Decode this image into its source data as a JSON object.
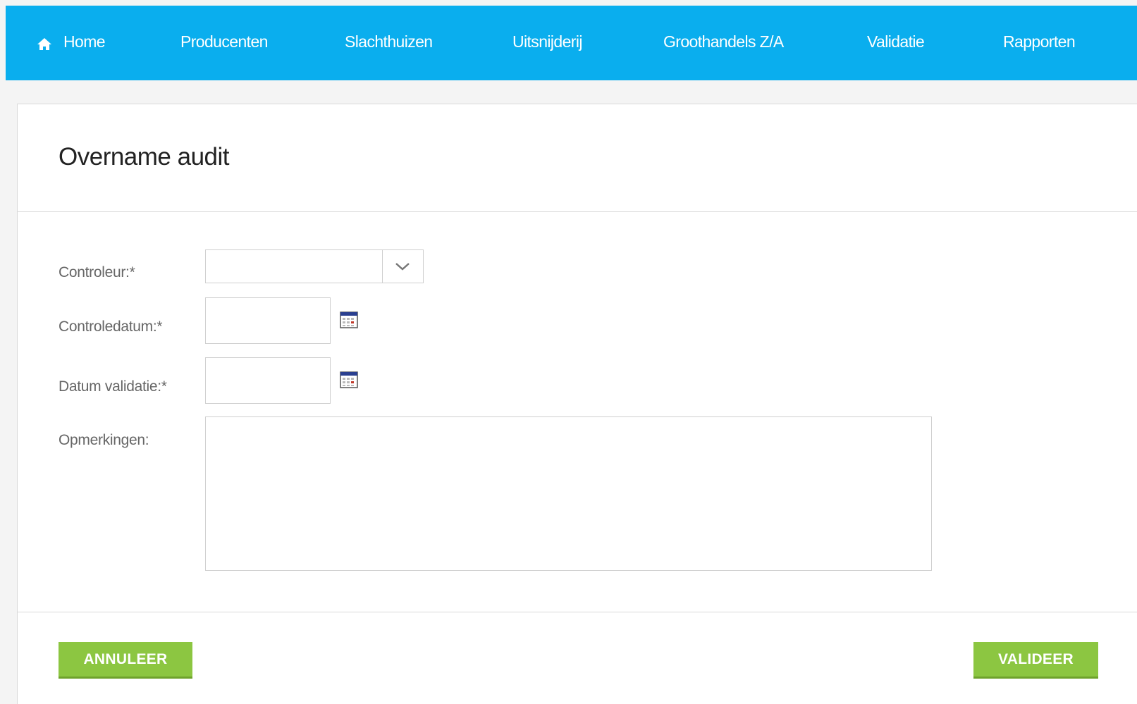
{
  "nav": {
    "home": "Home",
    "producenten": "Producenten",
    "slachthuizen": "Slachthuizen",
    "uitsnijderij": "Uitsnijderij",
    "groothandels": "Groothandels Z/A",
    "validatie": "Validatie",
    "rapporten": "Rapporten"
  },
  "page": {
    "title": "Overname audit"
  },
  "form": {
    "controleur_label": "Controleur:*",
    "controleur_value": "",
    "controledatum_label": "Controledatum:*",
    "controledatum_value": "",
    "datum_validatie_label": "Datum validatie:*",
    "datum_validatie_value": "",
    "opmerkingen_label": "Opmerkingen:",
    "opmerkingen_value": ""
  },
  "actions": {
    "cancel_label": "ANNULEER",
    "validate_label": "VALIDEER"
  },
  "icons": {
    "home": "home-icon",
    "dropdown": "chevron-down-icon",
    "calendar": "calendar-icon"
  },
  "colors": {
    "navbar": "#0aaeee",
    "button": "#8cc641",
    "background": "#f4f4f4"
  }
}
